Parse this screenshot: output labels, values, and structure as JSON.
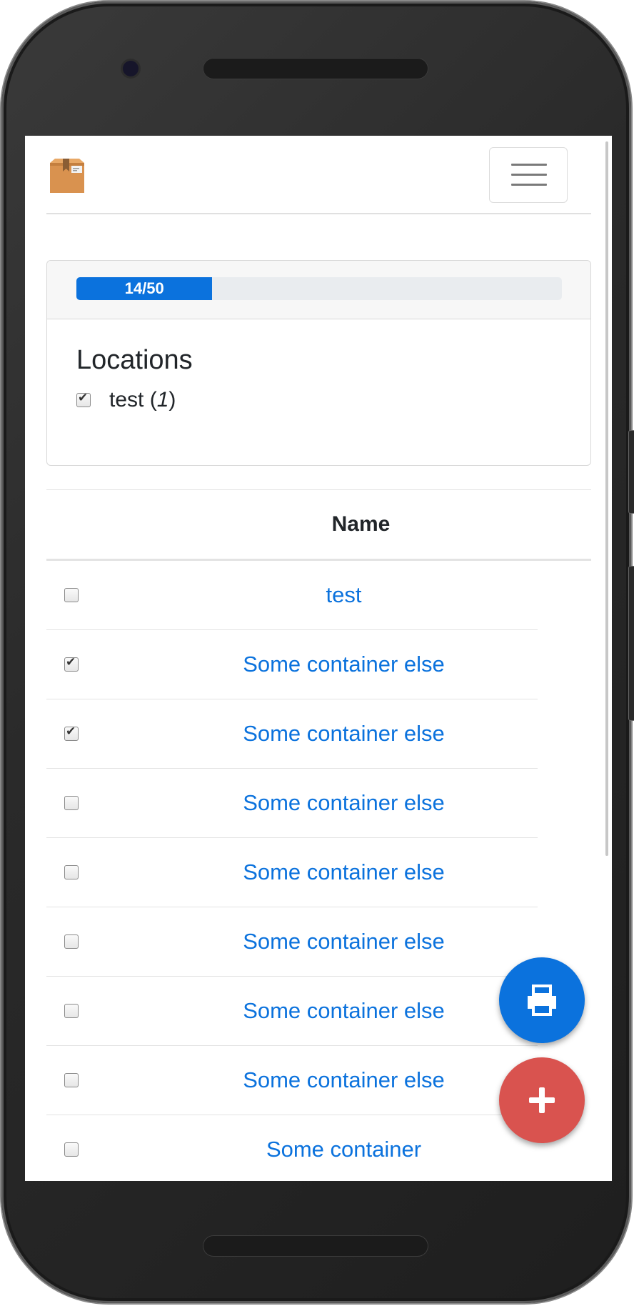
{
  "progress": {
    "label": "14/50",
    "fraction": 0.28
  },
  "locations": {
    "title": "Locations",
    "items": [
      {
        "name": "test",
        "count_open": " (",
        "count": "1",
        "count_close": ")",
        "checked": true
      }
    ]
  },
  "table": {
    "header": "Name",
    "rows": [
      {
        "name": "test",
        "checked": false
      },
      {
        "name": "Some container else",
        "checked": true
      },
      {
        "name": "Some container else",
        "checked": true
      },
      {
        "name": "Some container else",
        "checked": false
      },
      {
        "name": "Some container else",
        "checked": false
      },
      {
        "name": "Some container else",
        "checked": false
      },
      {
        "name": "Some container else",
        "checked": false
      },
      {
        "name": "Some container else",
        "checked": false
      },
      {
        "name": "Some container",
        "checked": false
      }
    ]
  },
  "icons": {
    "logo": "package-box-icon",
    "menu": "hamburger-menu-icon",
    "print": "printer-icon",
    "add": "plus-icon"
  },
  "colors": {
    "primary": "#0b72dd",
    "danger": "#d9534f",
    "link": "#0b72dd"
  }
}
